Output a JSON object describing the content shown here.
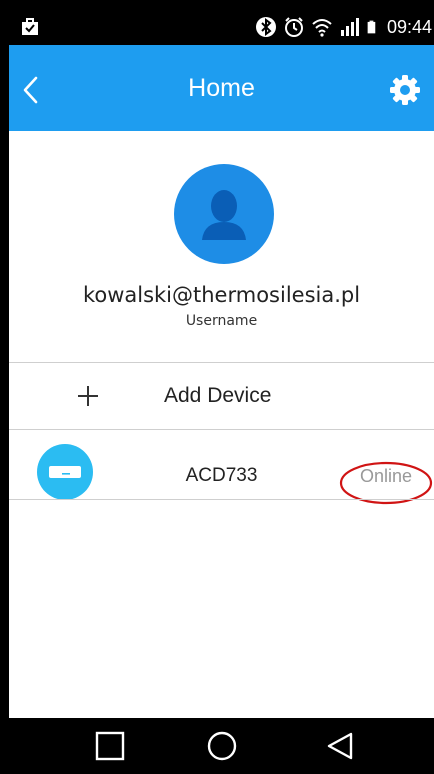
{
  "statusbar": {
    "time": "09:44",
    "icons": [
      "briefcase-icon",
      "bluetooth-icon",
      "alarm-icon",
      "wifi-icon",
      "signal-icon",
      "battery-icon"
    ]
  },
  "appbar": {
    "title": "Home",
    "back_icon": "chevron-left-icon",
    "settings_icon": "gear-icon",
    "color": "#1e9df0"
  },
  "profile": {
    "email": "kowalski@thermosilesia.pl",
    "subtitle": "Username",
    "avatar_icon": "user-icon",
    "avatar_color": "#1e8de6"
  },
  "add_device": {
    "icon": "plus-icon",
    "label": "Add Device"
  },
  "devices": [
    {
      "name": "ACD733",
      "status": "Online",
      "icon": "air-conditioner-icon",
      "icon_color": "#2bbcf2"
    }
  ],
  "navbar": {
    "buttons": [
      "recent-apps-icon",
      "home-icon",
      "back-triangle-icon"
    ]
  },
  "colors": {
    "status_highlight": "#d01414",
    "online_text": "#999999"
  }
}
